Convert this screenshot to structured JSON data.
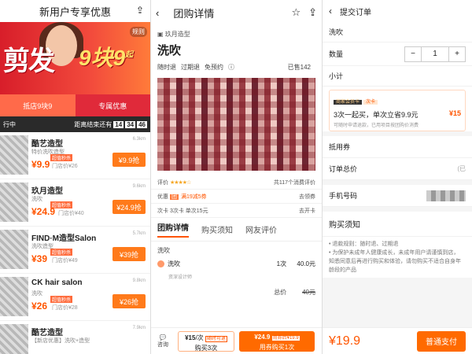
{
  "panel1": {
    "title": "新用户专享优惠",
    "banner": {
      "big_text": "剪发",
      "price_text": "9块9",
      "price_suffix": "起",
      "rule_label": "规则"
    },
    "tabs": [
      "抵店9块9",
      "专属优惠"
    ],
    "timer": {
      "left": "行中",
      "label": "距离结束还有",
      "h": "14",
      "m": "34",
      "s": "46"
    },
    "shops": [
      {
        "name": "酷艺造型",
        "sub": "特价洗吹造型",
        "tag": "超值秒杀",
        "price": "¥9.9",
        "orig": "门店价¥26",
        "btn": "¥9.9抢",
        "dist": "6.3km"
      },
      {
        "name": "玖月造型",
        "sub": "洗吹",
        "tag": "超值秒杀",
        "price": "¥24.9",
        "orig": "门店价¥40",
        "btn": "¥24.9抢",
        "dist": "9.6km"
      },
      {
        "name": "FIND·M造型Salon",
        "sub": "洗吹造型",
        "tag": "超值秒杀",
        "price": "¥39",
        "orig": "门店价¥49",
        "btn": "¥39抢",
        "dist": "5.7km"
      },
      {
        "name": "CK hair salon",
        "sub": "洗吹",
        "tag": "超值秒杀",
        "price": "¥26",
        "orig": "门店价¥28",
        "btn": "¥26抢",
        "dist": "9.8km"
      },
      {
        "name": "酷艺造型",
        "sub": "【新店优惠】洗吹+造型",
        "tag": "",
        "price": "",
        "orig": "",
        "btn": "",
        "dist": "7.9km"
      }
    ]
  },
  "panel2": {
    "title": "团购详情",
    "category": "玖月造型",
    "product": "洗吹",
    "features": [
      "随时退",
      "过期退",
      "免预约"
    ],
    "sold": "已售142",
    "rating_label": "评价",
    "stars": "★★★★☆",
    "rating_count": "共117个消费评价",
    "promo_label": "优惠",
    "promo_badge": "团",
    "promo_text": "满19减5券",
    "promo_action": "去领券",
    "card_label": "次卡",
    "card_text": "3次卡 单次15元",
    "card_action": "去开卡",
    "tabs": [
      "团购详情",
      "购买须知",
      "网友评价"
    ],
    "package_title": "洗吹",
    "item_name": "洗吹",
    "item_sub": "资深设计师",
    "item_qty": "1次",
    "item_price": "40.0元",
    "total_label": "总价",
    "total_value": "40元",
    "consult": "咨询",
    "btn1_price": "¥15",
    "btn1_unit": "/次",
    "btn1_badge": "随时可退",
    "btn1_label": "购买3次",
    "btn2_price": "¥24.9",
    "btn2_badge": "用券后¥19.9",
    "btn2_label": "用券购买1次"
  },
  "panel3": {
    "title": "提交订单",
    "item": "洗吹",
    "qty_label": "数量",
    "qty_value": "1",
    "subtotal_label": "小计",
    "card_tags": [
      "商家会员卡",
      "次卡"
    ],
    "card_line": "3次一起买，单次立省9.9元",
    "card_price": "¥15",
    "card_note": "可随时申请退款，已用项目按团购价消费",
    "coupon_label": "抵用券",
    "order_total_label": "订单总价",
    "order_total_note": "(已",
    "phone_label": "手机号码",
    "notice_title": "购买须知",
    "notice_lines": [
      "• 退款规则：随时退、过期退",
      "• 为保护未成年人健康成长，未成年用户请谨慎到店，",
      "知悉同意后再进行购买和体验，请勿购买不适合自身年",
      "龄段的产品"
    ],
    "pay_price": "¥19.9",
    "pay_btn": "普通支付"
  }
}
